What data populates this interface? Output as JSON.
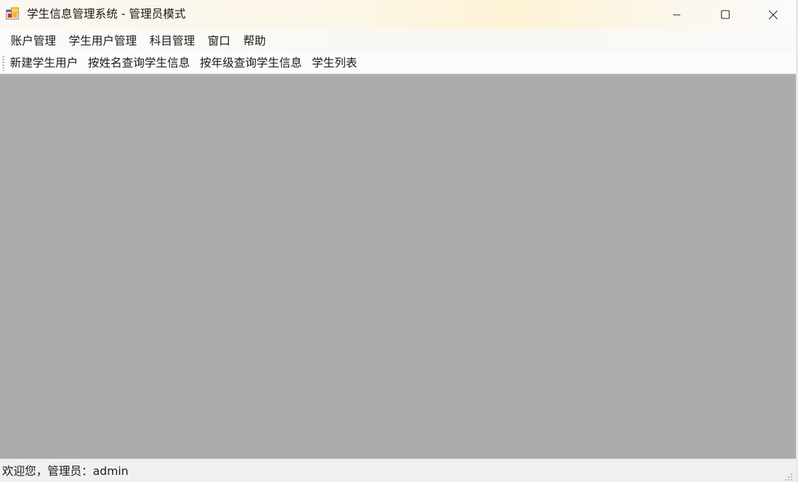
{
  "window": {
    "title": "学生信息管理系统 - 管理员模式",
    "icon": "app-window-icon",
    "controls": {
      "minimize": "minimize-icon",
      "maximize": "maximize-icon",
      "close": "close-icon"
    }
  },
  "menu": {
    "items": [
      "账户管理",
      "学生用户管理",
      "科目管理",
      "窗口",
      "帮助"
    ]
  },
  "toolbar": {
    "items": [
      "新建学生用户",
      "按姓名查询学生信息",
      "按年级查询学生信息",
      "学生列表"
    ]
  },
  "workspace": {
    "background_color": "#ababab"
  },
  "status": {
    "text": "欢迎您，管理员：admin"
  }
}
